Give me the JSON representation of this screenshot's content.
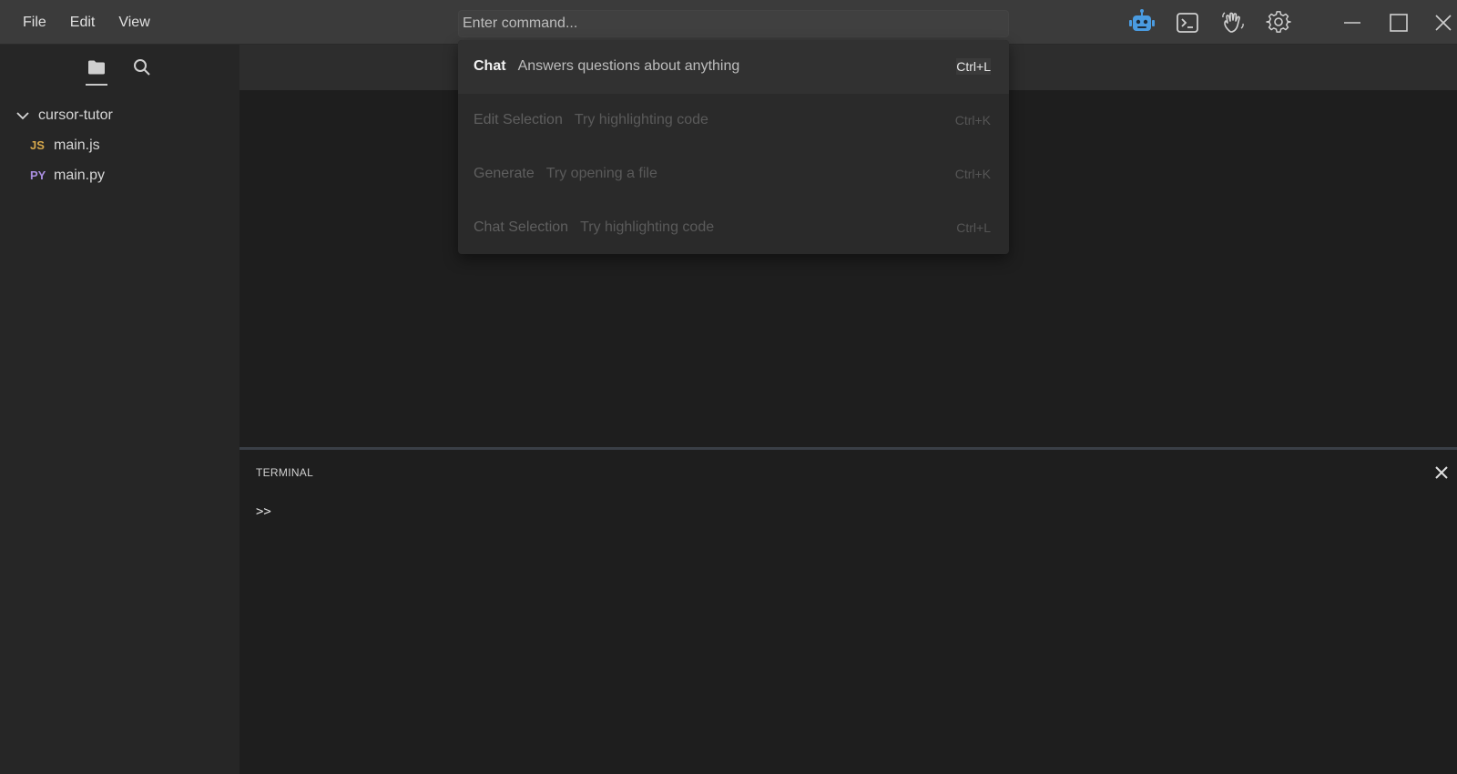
{
  "menu": {
    "items": [
      {
        "label": "File"
      },
      {
        "label": "Edit"
      },
      {
        "label": "View"
      }
    ]
  },
  "command": {
    "placeholder": "Enter command..."
  },
  "toolbar": {
    "icons": [
      "robot-icon",
      "terminal-icon",
      "hand-wave-icon",
      "gear-icon"
    ],
    "accent": "#4a9be0"
  },
  "window_controls": [
    "minimize-icon",
    "maximize-icon",
    "close-icon"
  ],
  "sidebar": {
    "tabs": [
      "folder-icon",
      "search-icon"
    ],
    "tree": {
      "folder": "cursor-tutor",
      "files": [
        {
          "badge": "JS",
          "name": "main.js"
        },
        {
          "badge": "PY",
          "name": "main.py"
        }
      ]
    }
  },
  "palette": {
    "items": [
      {
        "name": "Chat",
        "desc": "Answers questions about anything",
        "shortcut": "Ctrl+L",
        "active": true
      },
      {
        "name": "Edit Selection",
        "desc": "Try highlighting code",
        "shortcut": "Ctrl+K",
        "active": false
      },
      {
        "name": "Generate",
        "desc": "Try opening a file",
        "shortcut": "Ctrl+K",
        "active": false
      },
      {
        "name": "Chat Selection",
        "desc": "Try highlighting code",
        "shortcut": "Ctrl+L",
        "active": false
      }
    ]
  },
  "terminal": {
    "title": "TERMINAL",
    "prompt": ">>"
  }
}
